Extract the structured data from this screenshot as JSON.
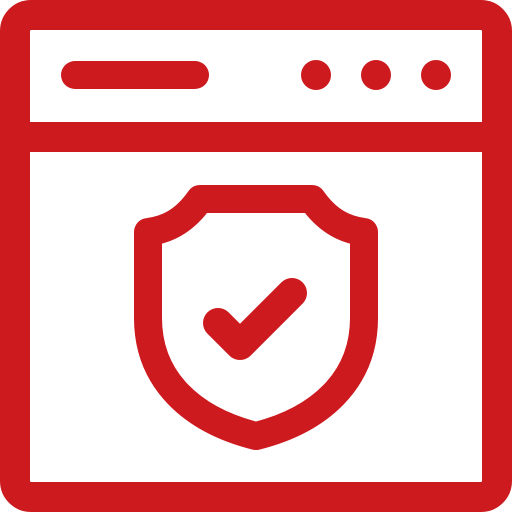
{
  "icon": {
    "name": "browser-window-security-shield-icon",
    "color": "#cc1a1f",
    "background": "#ffffff"
  }
}
